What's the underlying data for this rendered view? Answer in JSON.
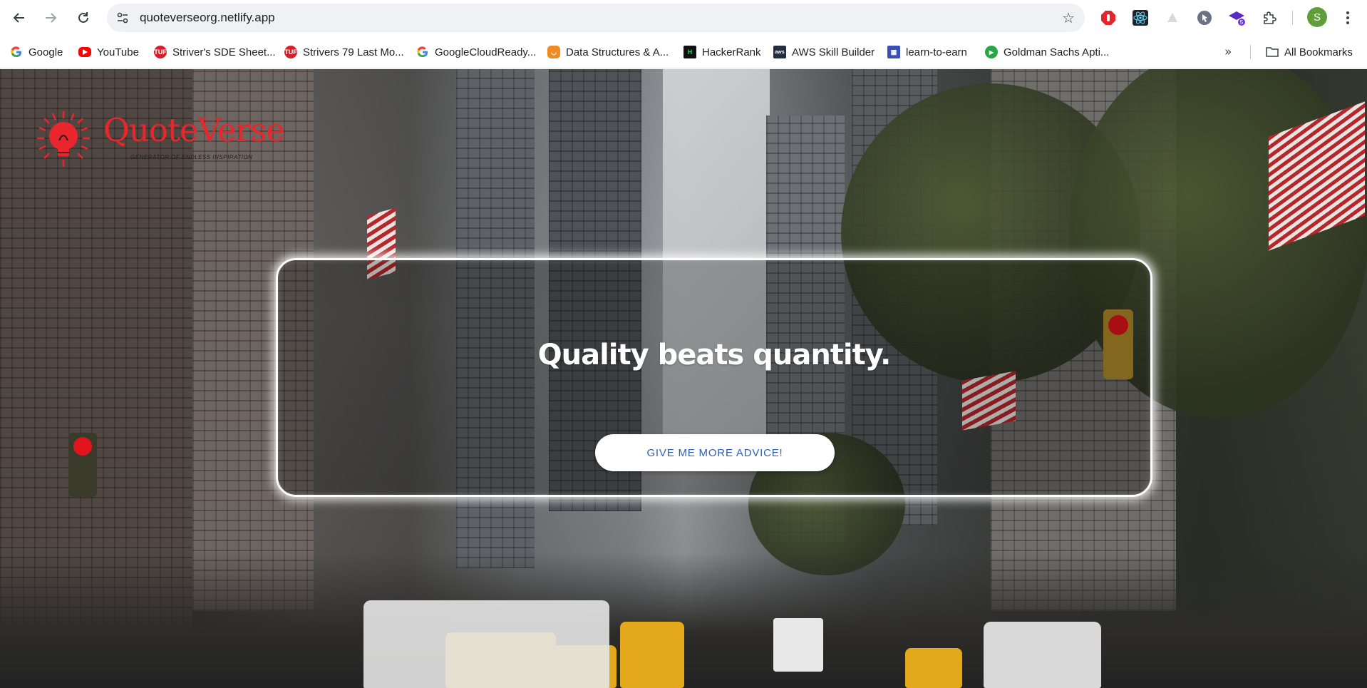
{
  "browser": {
    "url": "quoteverseorg.netlify.app",
    "icons": {
      "back": "arrow-left-icon",
      "forward": "arrow-right-icon",
      "reload": "reload-icon",
      "site_info": "tune-icon",
      "bookmark_star": "star-icon",
      "extensions": "puzzle-icon",
      "menu": "kebab-menu-icon"
    },
    "extension_badge": "5",
    "profile_initial": "S",
    "colors": {
      "toolbar_bg": "#ffffff",
      "omnibox_bg": "#eff1f4",
      "profile": "#5f9e3a"
    }
  },
  "bookmarks": {
    "items": [
      {
        "label": "Google",
        "icon": "google-icon"
      },
      {
        "label": "YouTube",
        "icon": "youtube-icon"
      },
      {
        "label": "Striver's SDE Sheet...",
        "icon": "tuf-icon"
      },
      {
        "label": "Strivers 79 Last Mo...",
        "icon": "tuf-icon"
      },
      {
        "label": "GoogleCloudReady...",
        "icon": "google-icon"
      },
      {
        "label": "Data Structures & A...",
        "icon": "coding-ninjas-icon"
      },
      {
        "label": "HackerRank",
        "icon": "hackerrank-icon"
      },
      {
        "label": "AWS Skill Builder",
        "icon": "aws-icon"
      },
      {
        "label": "learn-to-earn",
        "icon": "learn-icon"
      },
      {
        "label": "Goldman Sachs Apti...",
        "icon": "shield-play-icon"
      }
    ],
    "overflow_icon": "double-chevron-icon",
    "all_bookmarks": "All Bookmarks"
  },
  "page": {
    "logo": {
      "name": "QuoteVerse",
      "tagline": "GENERATOR OF ENDLESS INSPIRATION",
      "color": "#e8262c"
    },
    "quote": "Quality beats quantity.",
    "button_label": "GIVE ME MORE ADVICE!",
    "button_color": "#2f5fb5"
  }
}
